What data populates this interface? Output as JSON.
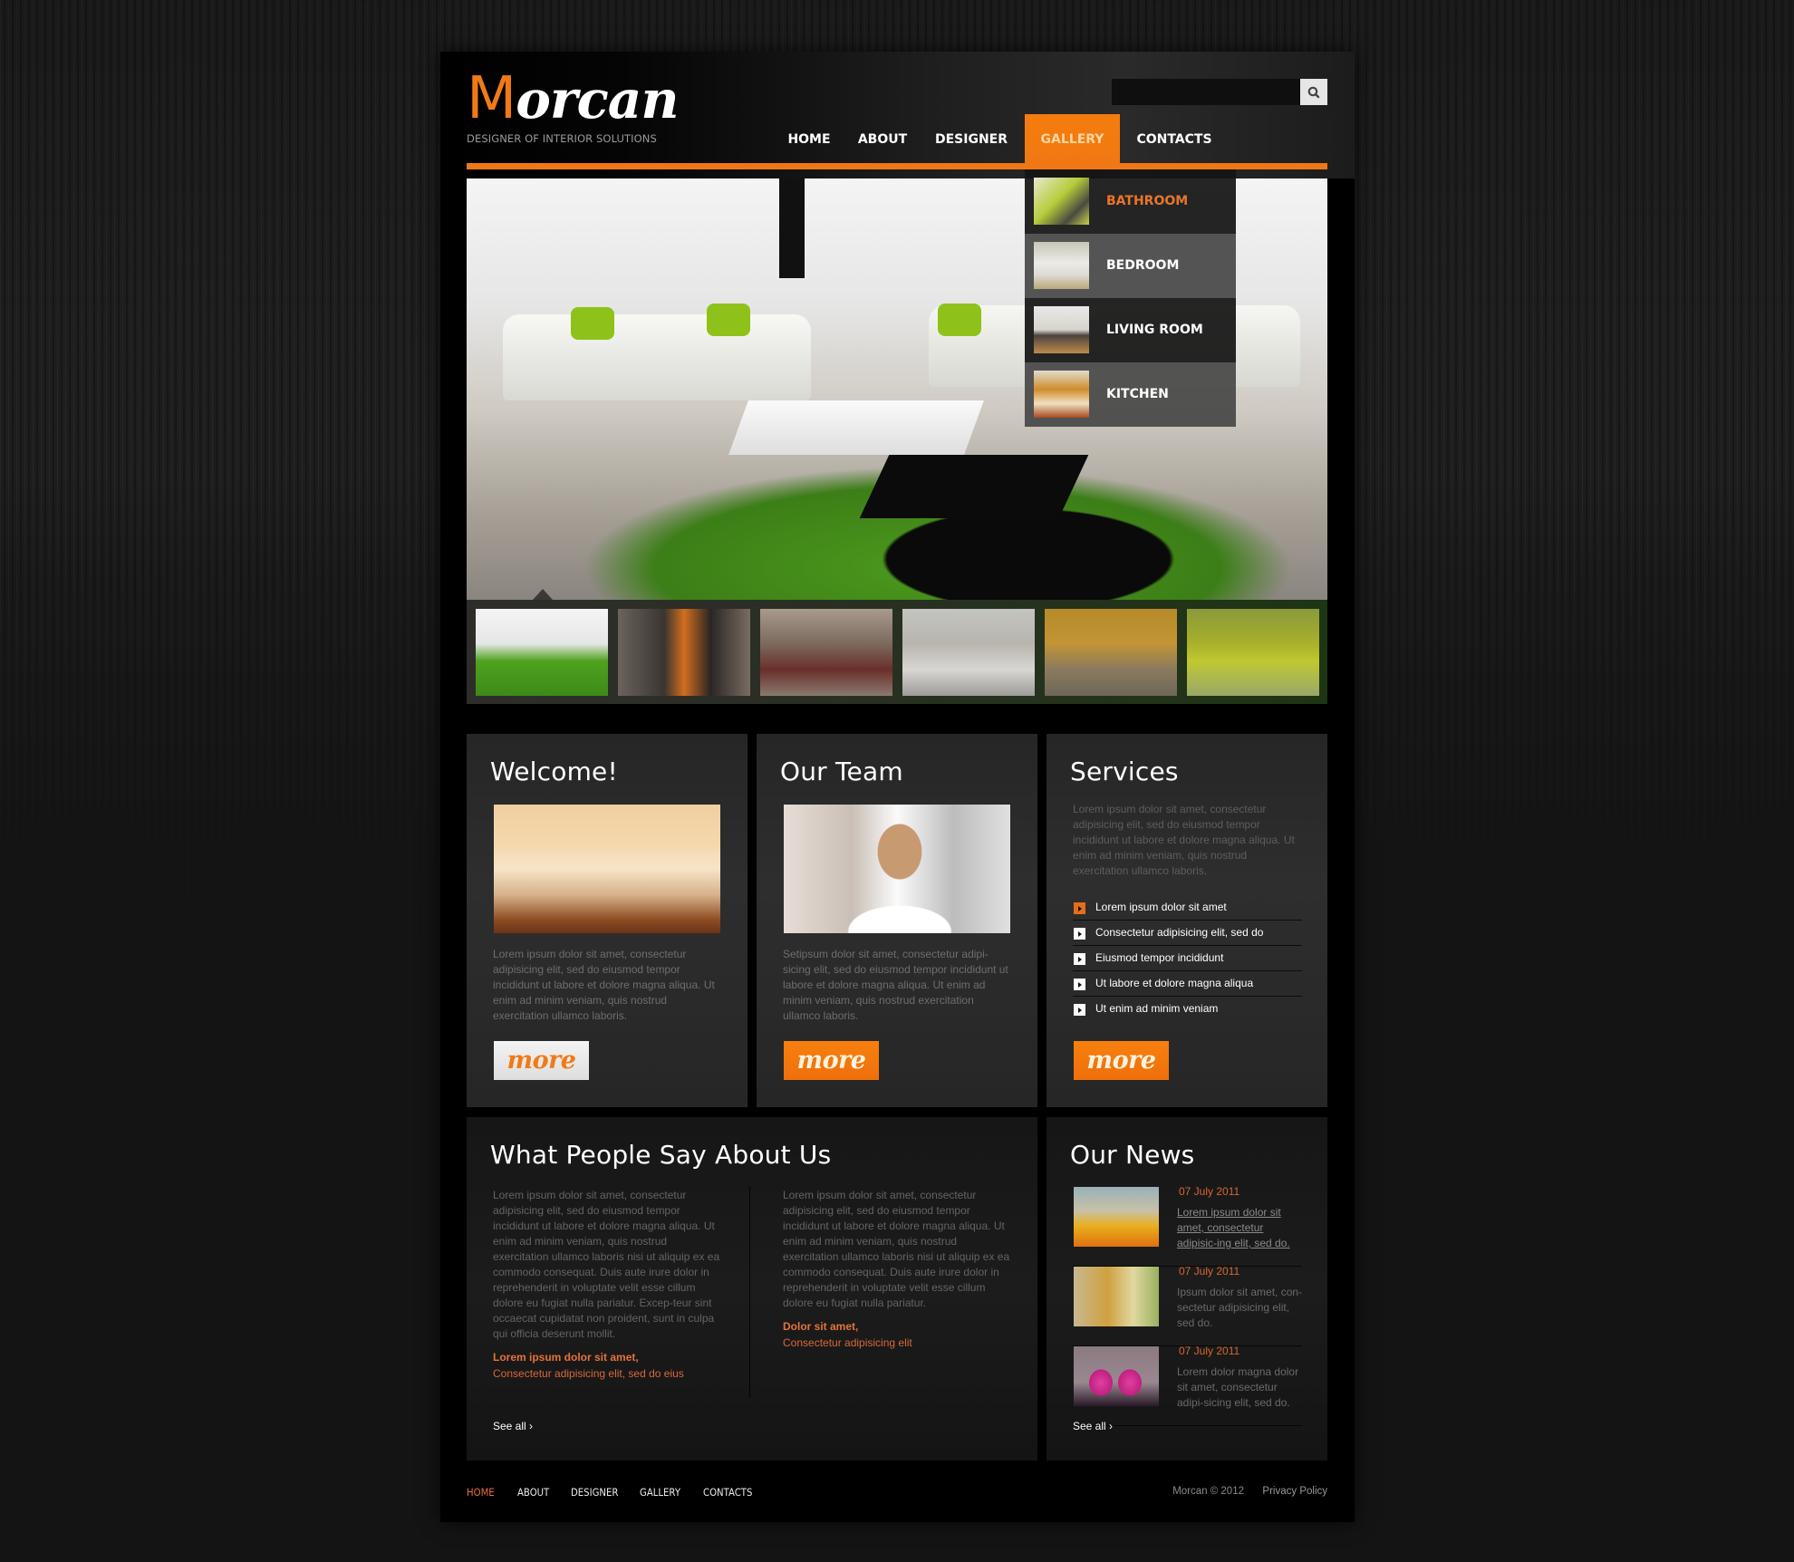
{
  "brand": {
    "logo_first": "M",
    "logo_rest": "orcan",
    "tagline": "DESIGNER OF INTERIOR SOLUTIONS"
  },
  "search": {
    "value": "",
    "placeholder": "",
    "button_icon": "search-icon"
  },
  "nav": {
    "items": [
      {
        "label": "HOME",
        "active": false
      },
      {
        "label": "ABOUT",
        "active": false
      },
      {
        "label": "DESIGNER",
        "active": false
      },
      {
        "label": "GALLERY",
        "active": true
      },
      {
        "label": "CONTACTS",
        "active": false
      }
    ]
  },
  "gallery_dropdown": {
    "items": [
      {
        "label": "BATHROOM",
        "active": true
      },
      {
        "label": "BEDROOM",
        "active": false
      },
      {
        "label": "LIVING ROOM",
        "active": false
      },
      {
        "label": "KITCHEN",
        "active": false
      }
    ]
  },
  "slider": {
    "thumbnails": [
      "living room green rug",
      "kitchen orange",
      "bedroom",
      "white living room",
      "yellow room",
      "green kitchen"
    ],
    "active_index": 0
  },
  "welcome": {
    "title": "Welcome!",
    "text": "Lorem ipsum dolor sit amet, consectetur adipisicing elit, sed do eiusmod tempor incididunt ut labore et dolore magna aliqua. Ut enim ad minim veniam, quis nostrud exercitation ullamco laboris.",
    "more_label": "more"
  },
  "team": {
    "title": "Our Team",
    "text": "Setipsum dolor sit amet, consectetur adipi-sicing elit, sed do eiusmod tempor incididunt ut labore et dolore magna aliqua. Ut enim ad minim veniam, quis nostrud exercitation ullamco laboris.",
    "more_label": "more"
  },
  "services": {
    "title": "Services",
    "text": "Lorem ipsum dolor sit amet, consectetur adipisicing elit, sed do eiusmod tempor incididunt ut labore et dolore magna aliqua. Ut enim ad minim veniam, quis nostrud exercitation ullamco laboris.",
    "items": [
      "Lorem ipsum dolor sit amet",
      "Consectetur adipisicing elit, sed do",
      "Eiusmod tempor incididunt",
      "Ut labore et dolore magna aliqua",
      "Ut enim ad minim veniam"
    ],
    "more_label": "more"
  },
  "testimonials": {
    "title": "What People Say About Us",
    "items": [
      {
        "text": "Lorem ipsum dolor sit amet, consectetur adipisicing elit, sed do eiusmod tempor incididunt ut labore et dolore magna aliqua. Ut enim ad minim veniam, quis nostrud exercitation ullamco laboris nisi ut aliquip ex ea commodo consequat. Duis aute irure dolor in reprehenderit in voluptate velit esse cillum dolore eu fugiat nulla pariatur. Excep-teur sint occaecat cupidatat non proident, sunt in culpa qui officia deserunt mollit.",
        "author": "Lorem ipsum dolor sit amet,",
        "role": "Consectetur adipisicing elit, sed do eius"
      },
      {
        "text": "Lorem ipsum dolor sit amet, consectetur adipisicing elit, sed do eiusmod tempor incididunt ut labore et dolore magna aliqua. Ut enim ad minim veniam, quis nostrud exercitation ullamco laboris nisi ut aliquip ex ea commodo consequat. Duis aute irure dolor in reprehenderit in voluptate velit esse cillum dolore eu fugiat nulla pariatur.",
        "author": "Dolor sit amet,",
        "role": "Consectetur adipisicing elit"
      }
    ],
    "see_all": "See all ›"
  },
  "news": {
    "title": "Our News",
    "items": [
      {
        "date": "07 July 2011",
        "text": "Lorem ipsum dolor sit amet, consectetur adipisic-ing elit, sed do.",
        "link": true
      },
      {
        "date": "07 July 2011",
        "text": "Ipsum dolor sit amet, con-sectetur adipisicing elit, sed do.",
        "link": false
      },
      {
        "date": "07 July 2011",
        "text": "Lorem dolor magna dolor sit amet, consectetur adipi-sicing elit, sed do.",
        "link": false
      }
    ],
    "see_all": "See all ›"
  },
  "footer": {
    "links": [
      {
        "label": "HOME",
        "active": true
      },
      {
        "label": "ABOUT",
        "active": false
      },
      {
        "label": "DESIGNER",
        "active": false
      },
      {
        "label": "GALLERY",
        "active": false
      },
      {
        "label": "CONTACTS",
        "active": false
      }
    ],
    "copyright": "Morcan © 2012",
    "privacy": "Privacy Policy"
  },
  "colors": {
    "accent": "#f07715",
    "background": "#141414",
    "panel": "#2a2a2a",
    "text_muted": "#6e6e6e"
  }
}
